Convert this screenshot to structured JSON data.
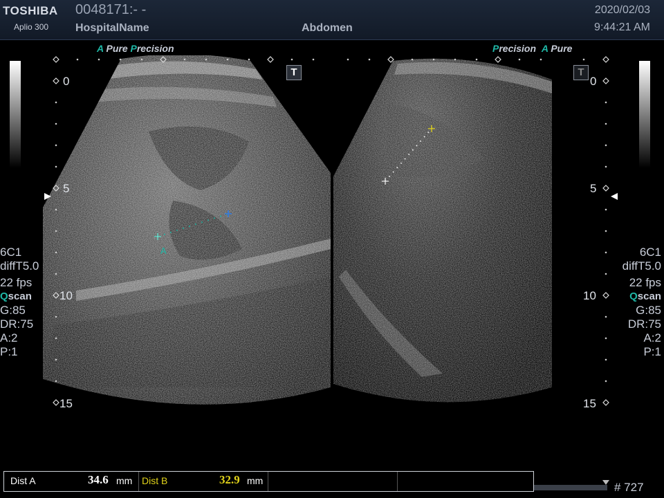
{
  "header": {
    "brand": "TOSHIBA",
    "model": "Aplio 300",
    "patient_id": "0048171:- -",
    "hospital": "HospitalName",
    "exam": "Abdomen",
    "date": "2020/02/03",
    "time": "9:44:21 AM"
  },
  "left_panel": {
    "labels": {
      "a": "A",
      "pure": "Pure",
      "p": "P",
      "recision": "recision"
    },
    "t_icon": "T",
    "depth_ticks": [
      "0",
      "5",
      "10",
      "15"
    ],
    "caliper_label": "A",
    "params": {
      "probe": "6C1",
      "mode": "diffT5.0",
      "fps": "22 fps",
      "q": "Q",
      "qscan": "scan",
      "gain": "G:85",
      "dr": "DR:75",
      "a": "A:2",
      "p": "P:1"
    }
  },
  "right_panel": {
    "labels": {
      "p": "P",
      "recision": "recision",
      "a": "A",
      "pure": "Pure"
    },
    "t_icon": "T",
    "depth_ticks": [
      "0",
      "5",
      "10",
      "15"
    ],
    "params": {
      "probe": "6C1",
      "mode": "diffT5.0",
      "fps": "22 fps",
      "q": "Q",
      "qscan": "scan",
      "gain": "G:85",
      "dr": "DR:75",
      "a": "A:2",
      "p": "P:1"
    }
  },
  "measurements": {
    "dist_a_label": "Dist A",
    "dist_a_value": "34.6",
    "dist_a_unit": "mm",
    "dist_b_label": "Dist B",
    "dist_b_value": "32.9",
    "dist_b_unit": "mm"
  },
  "frame_counter": "# 727",
  "colors": {
    "teal": "#1fb7a6",
    "caliper_b": "#e0d21a",
    "header_bg": "#1c2738"
  }
}
